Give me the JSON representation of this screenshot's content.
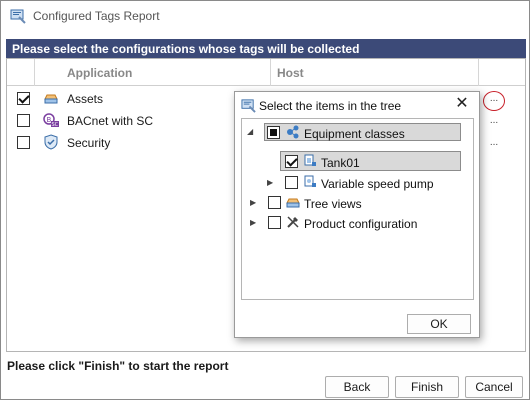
{
  "window": {
    "title": "Configured Tags Report"
  },
  "banner": "Please select the configurations whose tags will be collected",
  "table": {
    "columns": [
      "Application",
      "Host"
    ],
    "rows": [
      {
        "label": "Assets",
        "checked": true,
        "icon": "assets-icon",
        "action": "..."
      },
      {
        "label": "BACnet with SC",
        "checked": false,
        "icon": "bacnet-sc-icon",
        "action": "..."
      },
      {
        "label": "Security",
        "checked": false,
        "icon": "security-shield-icon",
        "action": "..."
      }
    ]
  },
  "footer": {
    "instruction": "Please click \"Finish\" to start the report"
  },
  "buttons": {
    "back": "Back",
    "finish": "Finish",
    "cancel": "Cancel"
  },
  "dialog": {
    "title": "Select the items in the tree",
    "close": "✕",
    "ok": "OK",
    "tree": [
      {
        "label": "Equipment classes",
        "state": "partial",
        "expanded": true,
        "icon": "equipment-classes-icon"
      },
      {
        "label": "Tank01",
        "state": "checked",
        "icon": "tank-icon"
      },
      {
        "label": "Variable speed pump",
        "state": "unchecked",
        "icon": "pump-icon"
      },
      {
        "label": "Tree views",
        "state": "unchecked",
        "icon": "tree-views-icon"
      },
      {
        "label": "Product configuration",
        "state": "unchecked",
        "icon": "product-configuration-icon"
      }
    ]
  },
  "colors": {
    "banner": "#3c4a78",
    "highlight": "#c8202a"
  }
}
